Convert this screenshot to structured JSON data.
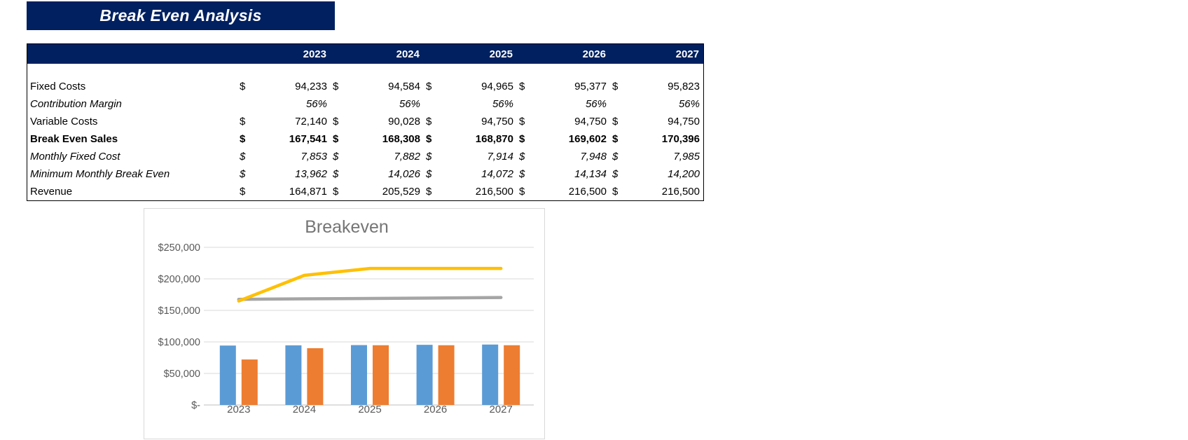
{
  "banner": {
    "title": "Break Even Analysis"
  },
  "table": {
    "years": [
      "2023",
      "2024",
      "2025",
      "2026",
      "2027"
    ],
    "currency_symbol": "$",
    "rows": [
      {
        "label": "Fixed Costs",
        "style": "normal",
        "currency": true,
        "values": [
          "94,233",
          "94,584",
          "94,965",
          "95,377",
          "95,823"
        ]
      },
      {
        "label": "Contribution Margin",
        "style": "italic",
        "currency": false,
        "values": [
          "56%",
          "56%",
          "56%",
          "56%",
          "56%"
        ]
      },
      {
        "label": "Variable Costs",
        "style": "normal",
        "currency": true,
        "values": [
          "72,140",
          "90,028",
          "94,750",
          "94,750",
          "94,750"
        ]
      },
      {
        "label": "Break Even Sales",
        "style": "bold",
        "currency": true,
        "values": [
          "167,541",
          "168,308",
          "168,870",
          "169,602",
          "170,396"
        ]
      },
      {
        "label": "Monthly Fixed Cost",
        "style": "italic",
        "currency": true,
        "values": [
          "7,853",
          "7,882",
          "7,914",
          "7,948",
          "7,985"
        ]
      },
      {
        "label": "Minimum Monthly Break Even",
        "style": "italic",
        "currency": true,
        "values": [
          "13,962",
          "14,026",
          "14,072",
          "14,134",
          "14,200"
        ]
      },
      {
        "label": "Revenue",
        "style": "normal",
        "currency": true,
        "values": [
          "164,871",
          "205,529",
          "216,500",
          "216,500",
          "216,500"
        ]
      }
    ]
  },
  "chart_data": {
    "type": "combo",
    "title": "Breakeven",
    "categories": [
      "2023",
      "2024",
      "2025",
      "2026",
      "2027"
    ],
    "series": [
      {
        "name": "Fixed Costs",
        "kind": "bar",
        "color": "#5B9BD5",
        "values": [
          94233,
          94584,
          94965,
          95377,
          95823
        ]
      },
      {
        "name": "Variable Costs",
        "kind": "bar",
        "color": "#ED7D31",
        "values": [
          72140,
          90028,
          94750,
          94750,
          94750
        ]
      },
      {
        "name": "Break Even Sales",
        "kind": "line",
        "color": "#A5A5A5",
        "values": [
          167541,
          168308,
          168870,
          169602,
          170396
        ]
      },
      {
        "name": "Revenue",
        "kind": "line",
        "color": "#FFC000",
        "values": [
          164871,
          205529,
          216500,
          216500,
          216500
        ]
      }
    ],
    "y_ticks": [
      "$250,000",
      "$200,000",
      "$150,000",
      "$100,000",
      "$50,000",
      "$-"
    ],
    "ylim": [
      0,
      250000
    ],
    "grid": true,
    "legend_visible": false,
    "title_color": "#757575",
    "axis_label_color": "#595959",
    "gridline_color": "#D9D9D9"
  },
  "colors": {
    "banner_bg": "#002060",
    "header_bg": "#002060",
    "header_text": "#ffffff",
    "table_border": "#000000"
  }
}
